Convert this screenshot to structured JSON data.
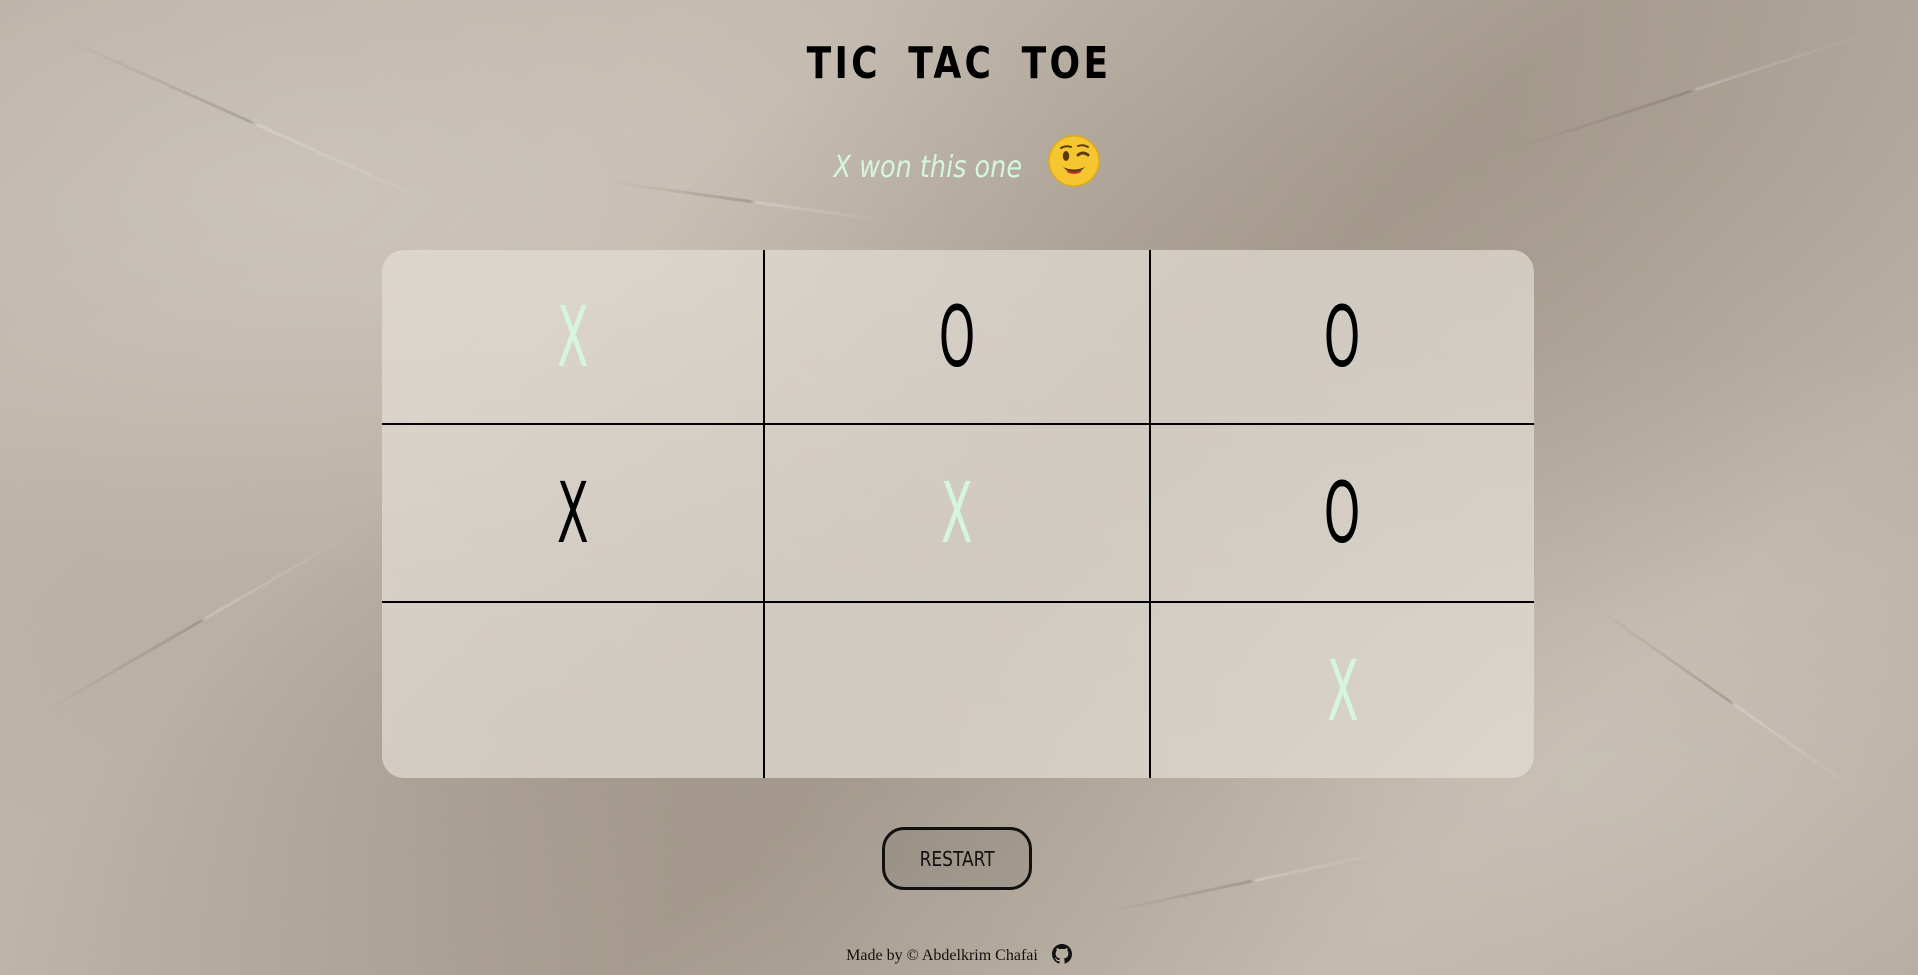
{
  "title": "TIC TAC TOE",
  "status": {
    "text": "X won this one",
    "emoji": "winking-face-emoji"
  },
  "board": {
    "cells": [
      {
        "mark": "X",
        "winning": true
      },
      {
        "mark": "O",
        "winning": false
      },
      {
        "mark": "O",
        "winning": false
      },
      {
        "mark": "X",
        "winning": false
      },
      {
        "mark": "X",
        "winning": true
      },
      {
        "mark": "O",
        "winning": false
      },
      {
        "mark": "",
        "winning": false
      },
      {
        "mark": "",
        "winning": false
      },
      {
        "mark": "X",
        "winning": true
      }
    ]
  },
  "restart_label": "RESTART",
  "footer": {
    "text": "Made by © Abdelkrim Chafai",
    "icon": "github-icon"
  },
  "colors": {
    "winning_mark": "#d6f5df",
    "normal_mark": "#000000"
  }
}
